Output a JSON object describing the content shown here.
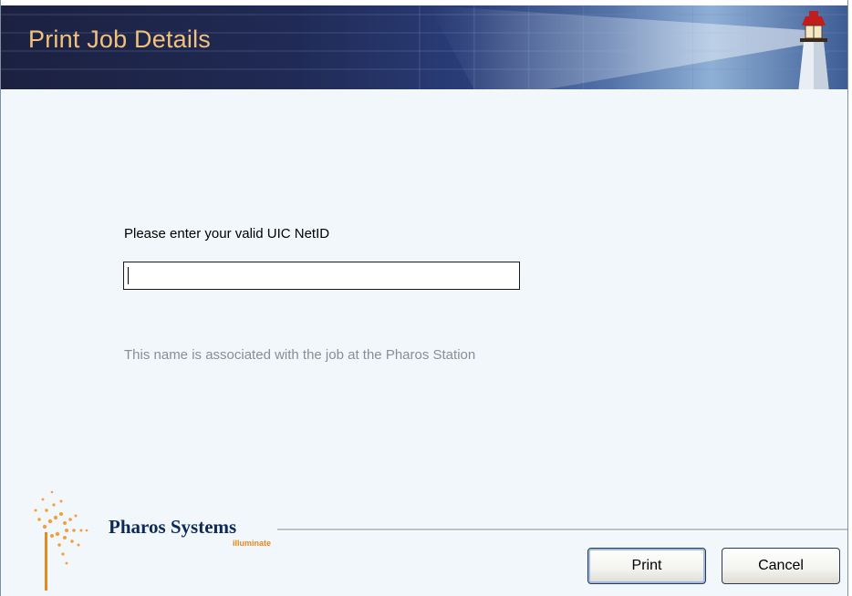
{
  "window": {
    "title": "Print Job Details"
  },
  "form": {
    "prompt_label": "Please enter your valid UIC NetID",
    "netid_value": "",
    "hint": "This name is associated with the job at the Pharos Station"
  },
  "footer": {
    "brand_name": "Pharos Systems",
    "brand_tagline": "illuminate",
    "print_label": "Print",
    "cancel_label": "Cancel"
  },
  "colors": {
    "title_text": "#f2c17a",
    "brand_text": "#0d2a57",
    "tagline_text": "#e58a1f",
    "hint_text": "#8a8e94",
    "body_background": "#f2f7fb"
  },
  "icons": {
    "banner_image": "lighthouse-icon",
    "logo": "sunburst-logo-icon"
  }
}
